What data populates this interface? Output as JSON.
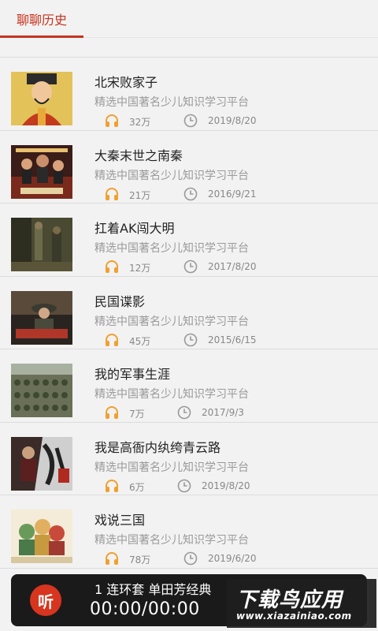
{
  "tab": {
    "label": "聊聊历史"
  },
  "items": [
    {
      "title": "北宋败家子",
      "subtitle": "精选中国著名少儿知识学习平台",
      "plays": "32万",
      "date": "2019/8/20"
    },
    {
      "title": "大秦末世之南秦",
      "subtitle": "精选中国著名少儿知识学习平台",
      "plays": "21万",
      "date": "2016/9/21"
    },
    {
      "title": "扛着AK闯大明",
      "subtitle": "精选中国著名少儿知识学习平台",
      "plays": "12万",
      "date": "2017/8/20"
    },
    {
      "title": "民国谍影",
      "subtitle": "精选中国著名少儿知识学习平台",
      "plays": "45万",
      "date": "2015/6/15"
    },
    {
      "title": "我的军事生涯",
      "subtitle": "精选中国著名少儿知识学习平台",
      "plays": "7万",
      "date": "2017/9/3"
    },
    {
      "title": "我是高衙内纨绔青云路",
      "subtitle": "精选中国著名少儿知识学习平台",
      "plays": "6万",
      "date": "2019/8/20"
    },
    {
      "title": "戏说三国",
      "subtitle": "精选中国著名少儿知识学习平台",
      "plays": "78万",
      "date": "2019/6/20"
    }
  ],
  "player": {
    "logo": "听",
    "track": "1 连环套  单田芳经典",
    "time": "00:00/00:00"
  },
  "watermark": {
    "text": "下载鸟应用",
    "url": "www.xiazainiao.com"
  },
  "colors": {
    "accent": "#c8321e",
    "icon": "#f0a030"
  }
}
